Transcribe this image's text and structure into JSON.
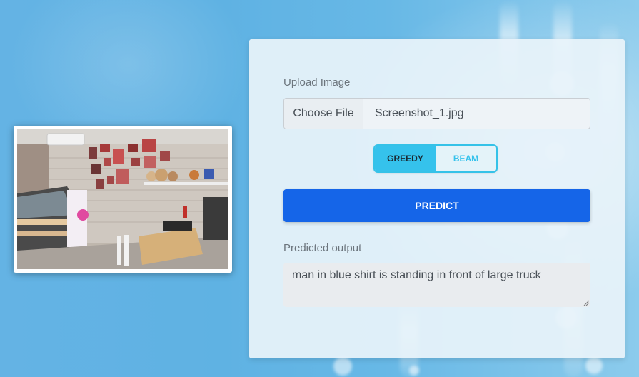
{
  "upload": {
    "label": "Upload Image",
    "choose_label": "Choose File",
    "file_name": "Screenshot_1.jpg"
  },
  "decoding": {
    "options": [
      "GREEDY",
      "BEAM"
    ],
    "selected": "GREEDY"
  },
  "predict_button": {
    "label": "PREDICT"
  },
  "output": {
    "label": "Predicted output",
    "value": "man in blue shirt is standing in front of large truck"
  },
  "colors": {
    "primary_button": "#1565e8",
    "toggle_accent": "#35c2ec",
    "background": "#64b3e4"
  }
}
